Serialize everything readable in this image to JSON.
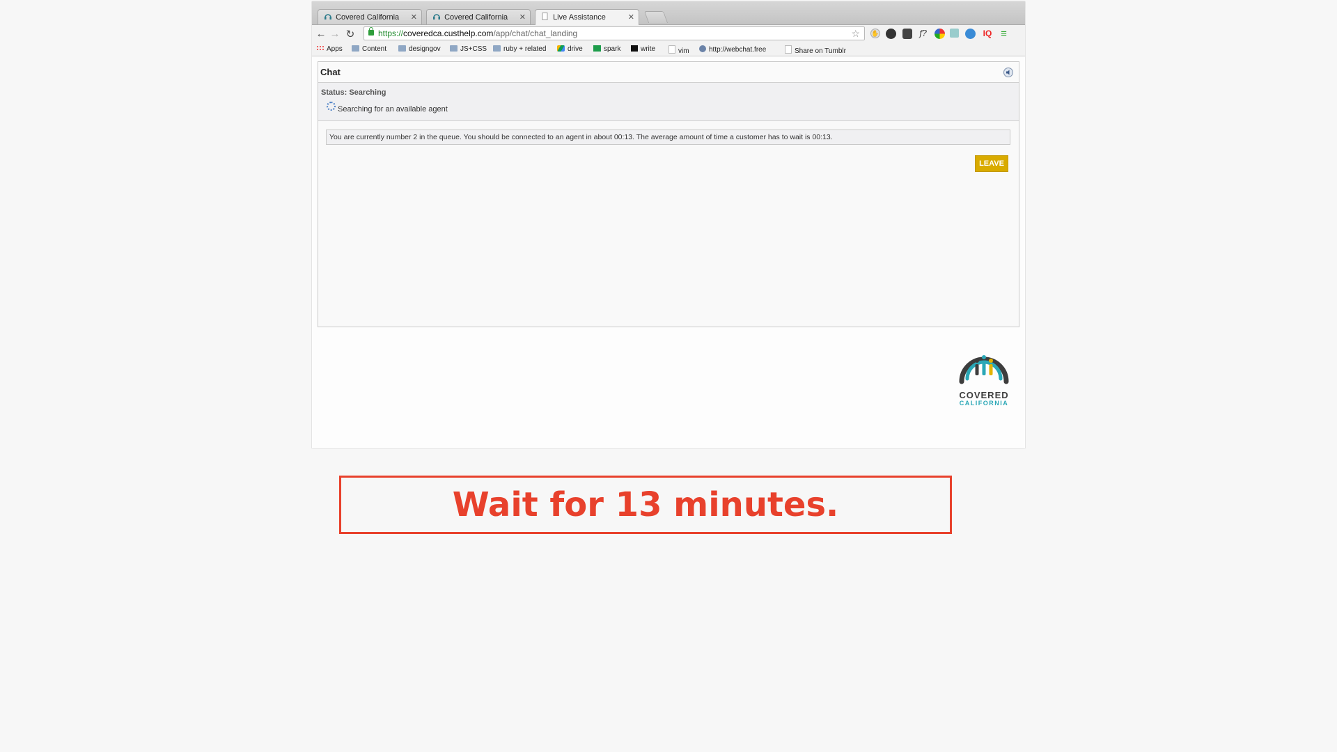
{
  "browser": {
    "tabs": [
      {
        "title": "Covered California",
        "active": false
      },
      {
        "title": "Covered California",
        "active": false
      },
      {
        "title": "Live Assistance",
        "active": true
      }
    ],
    "url": {
      "scheme": "https://",
      "host": "coveredca.custhelp.com",
      "path": "/app/chat/chat_landing"
    },
    "bookmarks": [
      {
        "label": "Apps",
        "icon": "apps-grid-icon"
      },
      {
        "label": "Content",
        "icon": "folder-icon"
      },
      {
        "label": "designgov",
        "icon": "folder-icon"
      },
      {
        "label": "JS+CSS",
        "icon": "folder-icon"
      },
      {
        "label": "ruby + related",
        "icon": "folder-icon"
      },
      {
        "label": "drive",
        "icon": "drive-icon"
      },
      {
        "label": "spark",
        "icon": "sheet-icon"
      },
      {
        "label": "write",
        "icon": "medium-icon"
      },
      {
        "label": "vim",
        "icon": "page-icon"
      },
      {
        "label": "http://webchat.free",
        "icon": "globe-icon"
      },
      {
        "label": "Share on Tumblr",
        "icon": "page-icon"
      }
    ]
  },
  "chat": {
    "title": "Chat",
    "status": "Status: Searching",
    "searching_text": "Searching for an available agent",
    "queue_message": "You are currently number 2 in the queue.  You should be connected to an agent in about 00:13.  The average amount of time a customer has to wait is 00:13.",
    "leave_label": "LEAVE",
    "leave_color": "#d9ab00"
  },
  "logo": {
    "line1": "COVERED",
    "line2": "CALIFORNIA"
  },
  "caption": {
    "text": "Wait for 13 minutes.",
    "color": "#e8412c"
  }
}
